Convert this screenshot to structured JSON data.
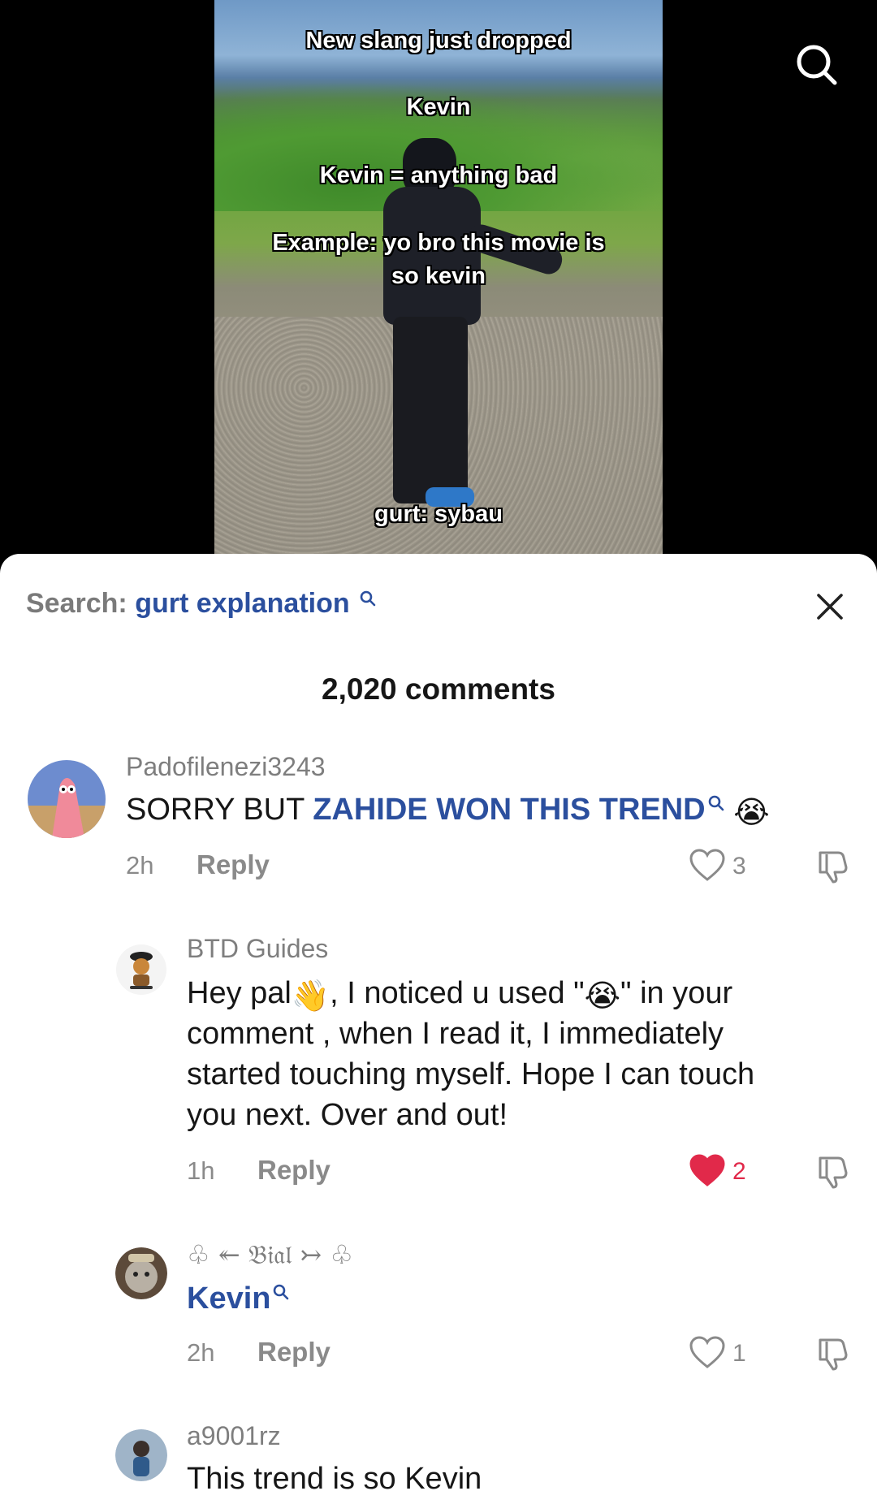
{
  "video": {
    "captions": [
      "New slang just dropped",
      "Kevin",
      "Kevin = anything bad",
      "Example: yo bro this movie is",
      "so kevin",
      "gurt: sybau"
    ]
  },
  "search": {
    "prefix": "Search:",
    "term": "gurt explanation"
  },
  "comments_header": {
    "count_label": "2,020 comments"
  },
  "comments": [
    {
      "username": "Padofilenezi3243",
      "text_plain": "SORRY BUT ",
      "text_link": "ZAHIDE WON THIS TREND",
      "emoji": "😭",
      "time": "2h",
      "reply_label": "Reply",
      "likes": "3",
      "liked": false
    },
    {
      "username": "BTD Guides",
      "line1_a": "Hey pal",
      "line1_emoji": "👋",
      "line1_b": ", I noticed u used \"",
      "line1_emoji2": "😭",
      "line1_c": "\" in your",
      "line2": "comment , when I read it, I immediately",
      "line3": "started touching myself. Hope I can touch",
      "line4": "you next. Over and out!",
      "time": "1h",
      "reply_label": "Reply",
      "likes": "2",
      "liked": true
    },
    {
      "username": "♧ ↞ 𝔅𝔦𝔞𝔩 ↣ ♧",
      "text_link": "Kevin",
      "time": "2h",
      "reply_label": "Reply",
      "likes": "1",
      "liked": false
    },
    {
      "username": "a9001rz",
      "text": "This trend is so Kevin"
    }
  ],
  "colors": {
    "link": "#2b4f9e",
    "like_active": "#e1294a",
    "muted": "#8a8a8a"
  },
  "icons": {
    "top_search": "search-icon",
    "close": "close-icon",
    "like": "heart-icon",
    "dislike": "thumbs-down-icon"
  }
}
